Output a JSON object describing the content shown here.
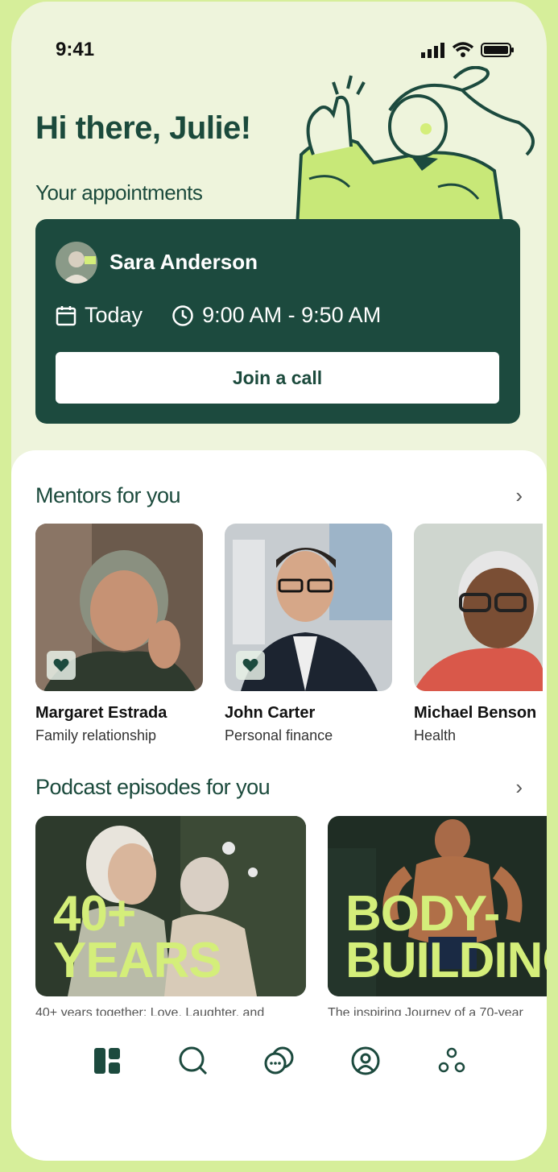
{
  "status": {
    "time": "9:41"
  },
  "greeting": "Hi there, Julie!",
  "appointments": {
    "heading": "Your appointments",
    "name": "Sara Anderson",
    "day": "Today",
    "time": "9:00 AM - 9:50 AM",
    "join_label": "Join a call"
  },
  "mentors": {
    "heading": "Mentors for you",
    "items": [
      {
        "name": "Margaret Estrada",
        "topic": "Family relationship"
      },
      {
        "name": "John Carter",
        "topic": "Personal finance"
      },
      {
        "name": "Michael Benson",
        "topic": "Health"
      }
    ]
  },
  "podcasts": {
    "heading": "Podcast episodes for you",
    "items": [
      {
        "cover_text_1": "40+",
        "cover_text_2": "YEARS",
        "caption": "40+ years together: Love, Laughter, and"
      },
      {
        "cover_text_1": "BODY-",
        "cover_text_2": "BUILDING",
        "caption": "The inspiring Journey of a 70-year"
      }
    ]
  },
  "tabs": [
    {
      "icon": "dashboard-icon"
    },
    {
      "icon": "search-icon"
    },
    {
      "icon": "chat-icon"
    },
    {
      "icon": "profile-icon"
    },
    {
      "icon": "more-icon"
    }
  ],
  "colors": {
    "accent": "#1c4a3e",
    "lime": "#d4ee7a",
    "background": "#eef4dc"
  }
}
